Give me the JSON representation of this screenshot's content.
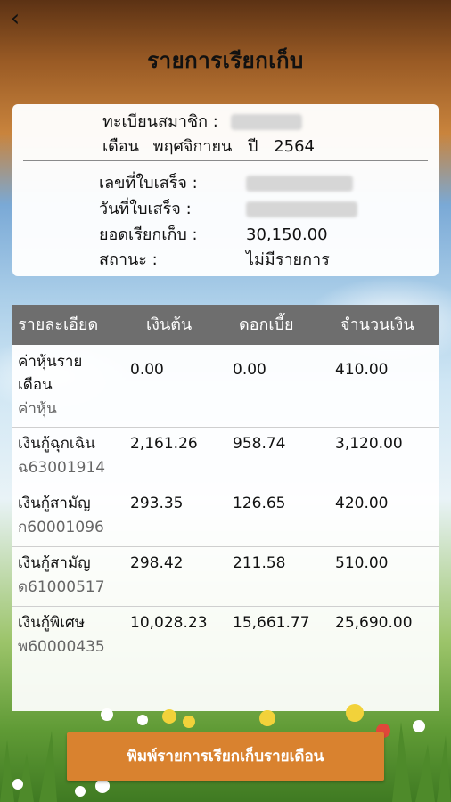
{
  "header": {
    "back_icon": "chevron-left-icon",
    "title": "รายการเรียกเก็บ"
  },
  "info": {
    "member_label": "ทะเบียนสมาชิก :",
    "month_label": "เดือน",
    "month_value": "พฤศจิกายน",
    "year_label": "ปี",
    "year_value": "2564",
    "receipt_no_label": "เลขที่ใบเสร็จ :",
    "receipt_date_label": "วันที่ใบเสร็จ :",
    "total_label": "ยอดเรียกเก็บ :",
    "total_value": "30,150.00",
    "status_label": "สถานะ :",
    "status_value": "ไม่มีรายการ"
  },
  "table": {
    "headers": [
      "รายละเอียด",
      "เงินต้น",
      "ดอกเบี้ย",
      "จำนวนเงิน"
    ],
    "rows": [
      {
        "name": "ค่าหุ้นราย",
        "name2": "เดือน",
        "code": "ค่าหุ้น",
        "principal": "0.00",
        "interest": "0.00",
        "amount": "410.00"
      },
      {
        "name": "เงินกู้ฉุกเฉิน",
        "code": "ฉ63001914",
        "principal": "2,161.26",
        "interest": "958.74",
        "amount": "3,120.00"
      },
      {
        "name": "เงินกู้สามัญ",
        "code": "ก60001096",
        "principal": "293.35",
        "interest": "126.65",
        "amount": "420.00"
      },
      {
        "name": "เงินกู้สามัญ",
        "code": "ด61000517",
        "principal": "298.42",
        "interest": "211.58",
        "amount": "510.00"
      },
      {
        "name": "เงินกู้พิเศษ",
        "code": "พ60000435",
        "principal": "10,028.23",
        "interest": "15,661.77",
        "amount": "25,690.00"
      }
    ]
  },
  "footer": {
    "print_button": "พิมพ์รายการเรียกเก็บรายเดือน"
  }
}
